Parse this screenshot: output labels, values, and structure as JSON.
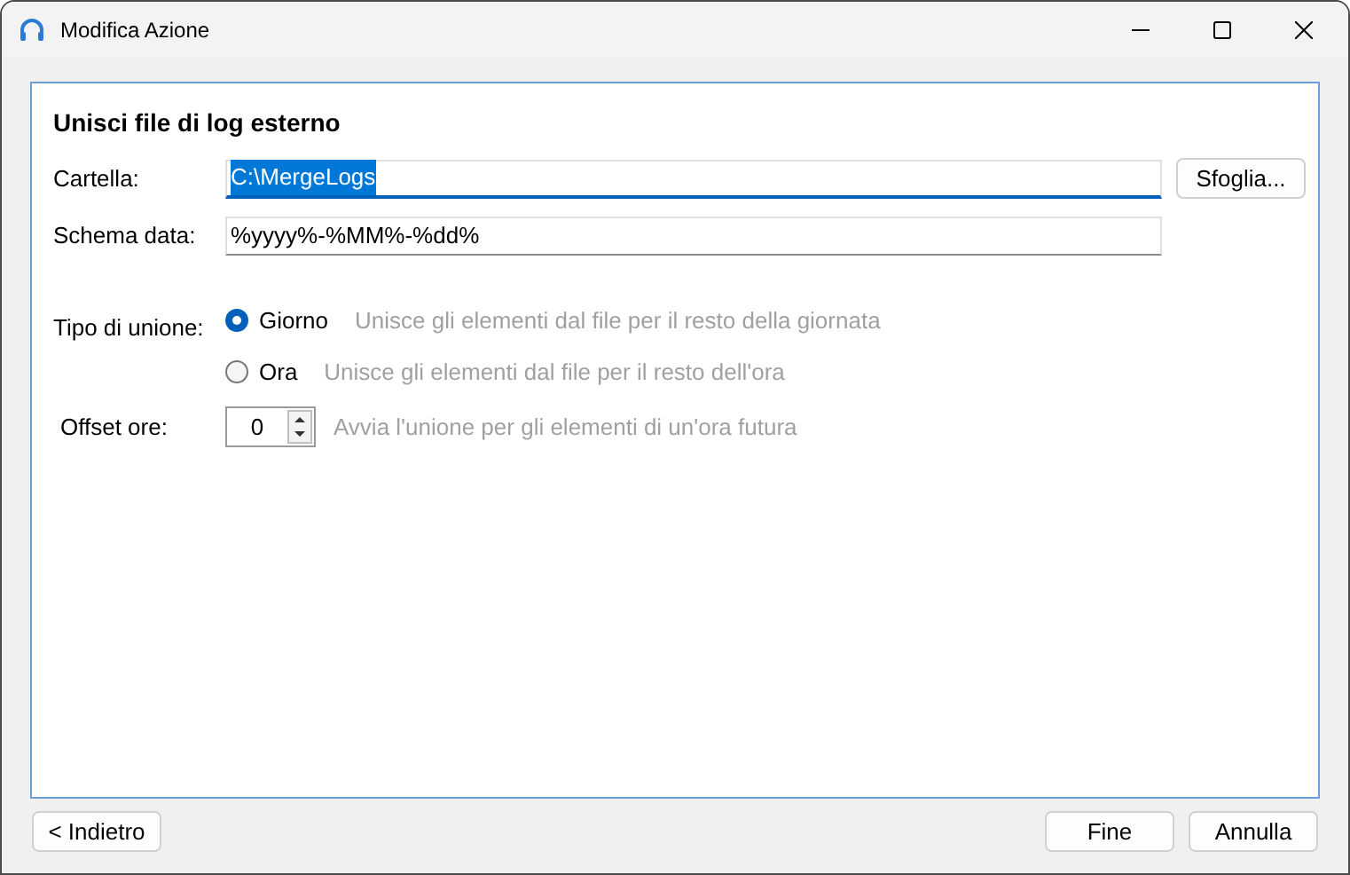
{
  "window": {
    "title": "Modifica Azione"
  },
  "heading": "Unisci file di log esterno",
  "folder": {
    "label": "Cartella:",
    "value": "C:\\MergeLogs",
    "focused": true,
    "text_selected": true,
    "browse_button": "Sfoglia..."
  },
  "date_pattern": {
    "label": "Schema data:",
    "value": "%yyyy%-%MM%-%dd%"
  },
  "merge_type": {
    "label": "Tipo di unione:",
    "options": [
      {
        "label": "Giorno",
        "description": "Unisce gli elementi dal file per il resto della giornata",
        "selected": true
      },
      {
        "label": "Ora",
        "description": "Unisce gli elementi dal file per il resto dell'ora",
        "selected": false
      }
    ]
  },
  "hour_offset": {
    "label": "Offset ore:",
    "value": "0",
    "description": "Avvia l'unione per gli elementi di un'ora futura"
  },
  "footer": {
    "back": "< Indietro",
    "finish": "Fine",
    "cancel": "Annulla"
  }
}
